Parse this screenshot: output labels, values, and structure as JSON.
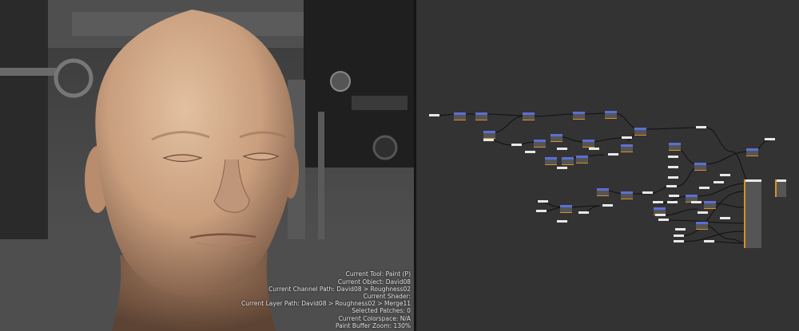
{
  "viewport": {
    "subject": "3D head model",
    "hud": [
      "Current Tool: Paint (P)",
      "Current Object: David08",
      "Current Channel Path: David08 > Roughness02",
      "Current Shader:",
      "Current Layer Path: David08 > Roughness02 > Merge11",
      "Selected Patches: 0",
      "Current Colorspace: N/A",
      "Paint Buffer Zoom: 130%"
    ]
  },
  "colors": {
    "graph_bg": "#333333",
    "node_plain": "#e8e8e8",
    "node_header": "#5b6fd6",
    "node_body": "#555555",
    "wire": "#101010",
    "accent_orange": "#d8902a"
  }
}
